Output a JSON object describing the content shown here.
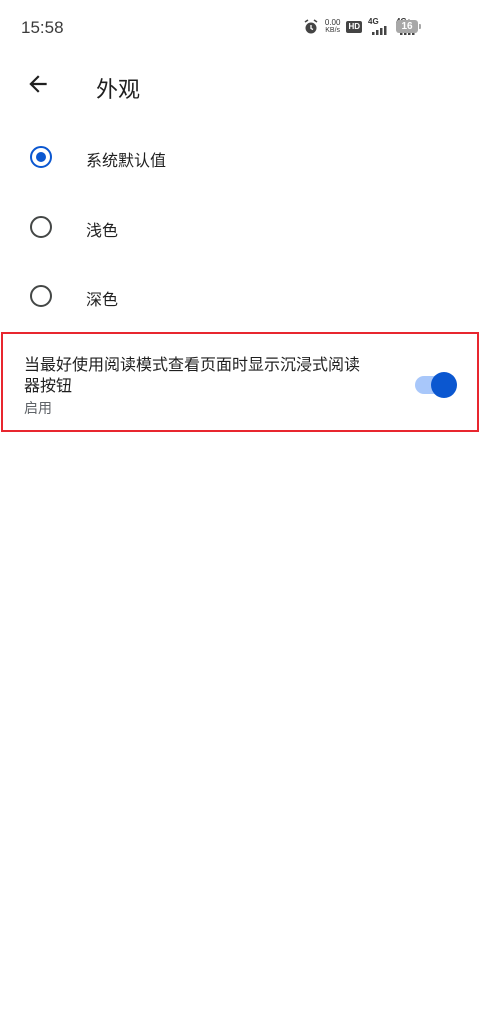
{
  "status_bar": {
    "time": "15:58",
    "net_speed_value": "0.00",
    "net_speed_unit": "KB/s",
    "hd_label": "HD",
    "signal1_label": "4G",
    "signal2_label": "4G+",
    "battery": "16",
    "icons": [
      "alarm-icon",
      "hd-icon",
      "signal-4g-icon",
      "signal-4g-plus-icon",
      "battery-icon"
    ]
  },
  "app_bar": {
    "title": "外观",
    "back_icon": "arrow-back-icon"
  },
  "theme_options": [
    {
      "label": "系统默认值",
      "selected": true
    },
    {
      "label": "浅色",
      "selected": false
    },
    {
      "label": "深色",
      "selected": false
    }
  ],
  "reader_setting": {
    "title": "当最好使用阅读模式查看页面时显示沉浸式阅读器按钮",
    "summary": "启用",
    "enabled": true
  },
  "colors": {
    "accent": "#0b57d0",
    "toggle_track": "#a8c7fa",
    "highlight_border": "#e8262f",
    "background": "#ffffff"
  }
}
